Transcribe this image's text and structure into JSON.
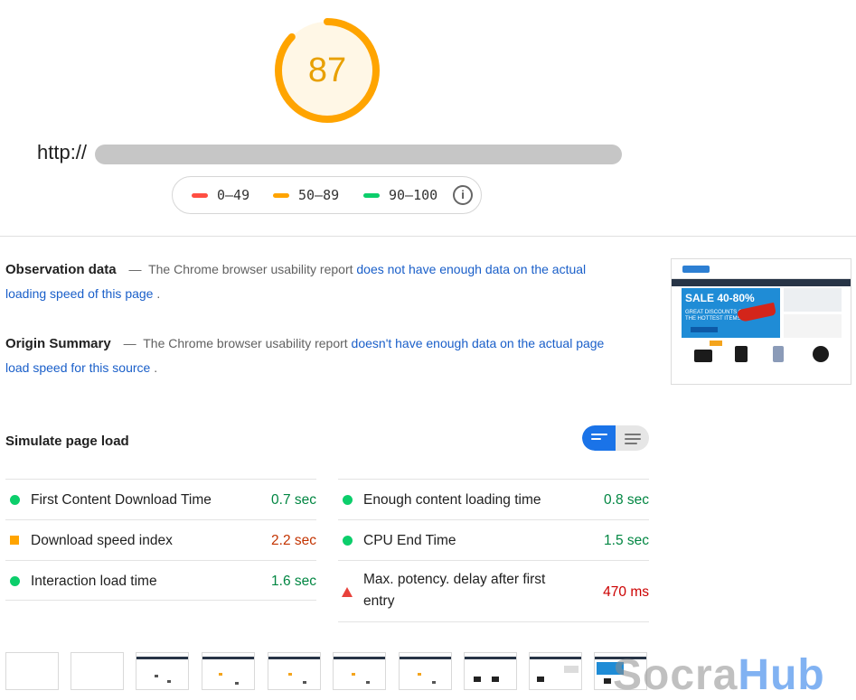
{
  "score": {
    "value": "87",
    "fraction": 0.87,
    "color": "#ffa400"
  },
  "url": {
    "prefix": "http://"
  },
  "legend": {
    "items": [
      {
        "label": "0–49",
        "color": "#ff4e42"
      },
      {
        "label": "50–89",
        "color": "#ffa400"
      },
      {
        "label": "90–100",
        "color": "#0cce6b"
      }
    ],
    "info_icon": "info-icon"
  },
  "observation": {
    "title": "Observation data",
    "dash": "—",
    "text": "The Chrome browser usability report",
    "link": "does not have enough data on the actual loading speed of this page",
    "end": "."
  },
  "origin": {
    "title": "Origin Summary",
    "dash": "—",
    "text": "The Chrome browser usability report",
    "link": "doesn't have enough data on the actual page load speed for this source",
    "end": "."
  },
  "thumbnail": {
    "sale_text": "SALE 40-80%",
    "sub_text": "GREAT DISCOUNTS ON THE HOTTEST ITEMS"
  },
  "simulate": {
    "title": "Simulate page load",
    "toggle_icons": [
      "compact-view-icon",
      "list-view-icon"
    ]
  },
  "metrics": {
    "left": [
      {
        "label": "First Content Download Time",
        "value": "0.7 sec",
        "status": "pass",
        "color": "#0cce6b",
        "value_color": "#018642"
      },
      {
        "label": "Download speed index",
        "value": "2.2 sec",
        "status": "average",
        "color": "#ffa400",
        "value_color": "#c33300"
      },
      {
        "label": "Interaction load time",
        "value": "1.6 sec",
        "status": "pass",
        "color": "#0cce6b",
        "value_color": "#018642"
      }
    ],
    "right": [
      {
        "label": "Enough content loading time",
        "value": "0.8 sec",
        "status": "pass",
        "color": "#0cce6b",
        "value_color": "#018642"
      },
      {
        "label": "CPU End Time",
        "value": "1.5 sec",
        "status": "pass",
        "color": "#0cce6b",
        "value_color": "#018642"
      },
      {
        "label": "Max. potency. delay after first entry",
        "value": "470 ms",
        "status": "fail",
        "color": "#ff4e42",
        "value_color": "#cc0000"
      }
    ]
  },
  "watermark": {
    "part1": "Socra",
    "part2": "Hub"
  }
}
